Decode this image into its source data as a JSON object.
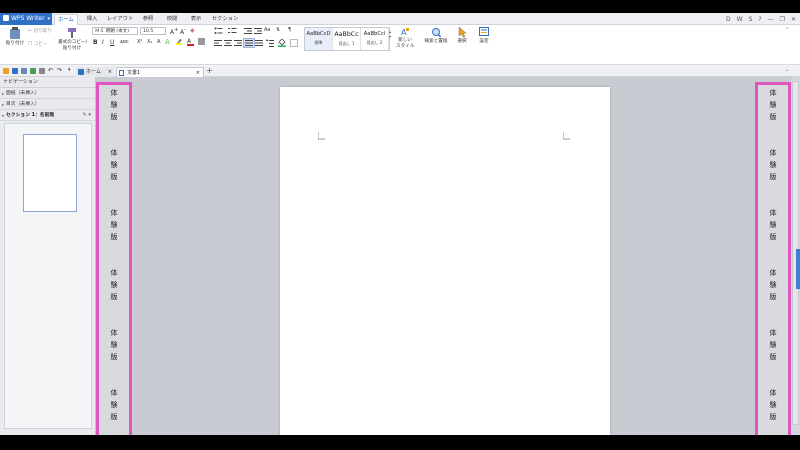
{
  "app": {
    "name": "WPS Writer"
  },
  "ribbon_tabs": [
    "ホーム",
    "挿入",
    "レイアウト",
    "参照",
    "校閲",
    "表示",
    "セクション"
  ],
  "window_controls": [
    "D",
    "W",
    "S",
    "?",
    "—",
    "❐",
    "✕"
  ],
  "ribbon": {
    "paste": "貼り付け",
    "cut": "切り取り",
    "copy": "コピー",
    "format_painter_1": "書式のコピー/",
    "format_painter_2": "貼り付け",
    "font_name": "ＭＳ 明朝 (本文)",
    "font_size": "10.5",
    "styles": [
      {
        "preview": "AaBbCcD",
        "label": "標準"
      },
      {
        "preview": "AaBbCc",
        "label": "見出し 1"
      },
      {
        "preview": "AaBbCcl",
        "label": "見出し 2"
      }
    ],
    "new_style_1": "新しい",
    "new_style_2": "スタイル",
    "find_replace": "検索と置換",
    "select": "選択",
    "settings": "設定"
  },
  "quick_access": {
    "home_tab": "ホーム",
    "doc_tab": "文書1"
  },
  "navigation": {
    "title": "ナビゲーション",
    "items": [
      "面紙（未挿入）",
      "目次（未挿入）"
    ],
    "section": "セクション 1：名前無"
  },
  "trial": {
    "chars": [
      "体",
      "験",
      "版"
    ],
    "repeat": 6
  },
  "colors": {
    "accent": "#2f6fc6",
    "trial_border": "#e055c0"
  }
}
